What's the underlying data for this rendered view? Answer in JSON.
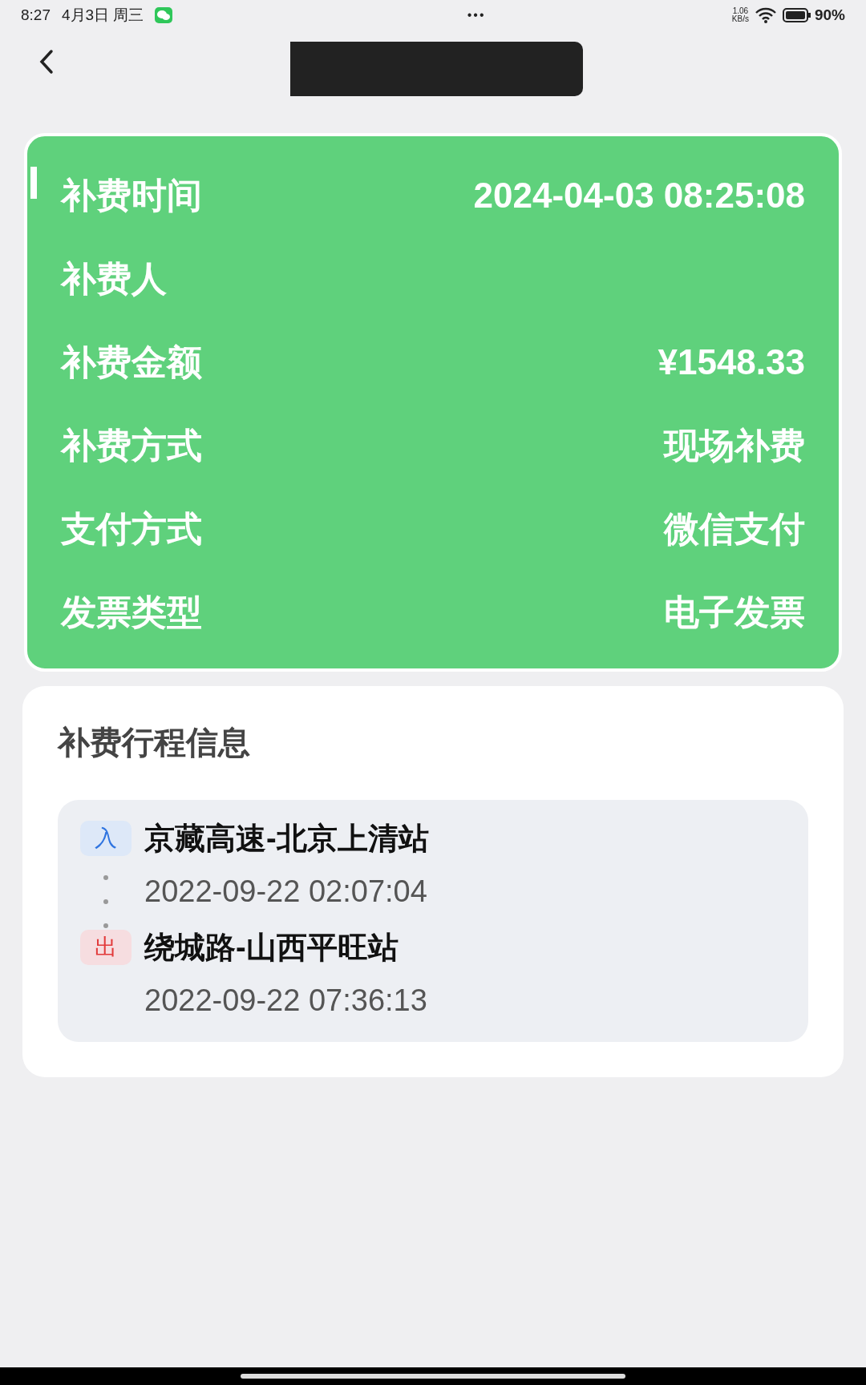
{
  "status_bar": {
    "time": "8:27",
    "date": "4月3日 周三",
    "dots": "•••",
    "speed": "1.06",
    "speed_unit": "KB/s",
    "battery": "90%"
  },
  "details": [
    {
      "label": "补费时间",
      "value": "2024-04-03 08:25:08"
    },
    {
      "label": "补费人"
    },
    {
      "label": "补费金额",
      "value": "¥1548.33"
    },
    {
      "label": "补费方式",
      "value": "现场补费"
    },
    {
      "label": "支付方式",
      "value": "微信支付"
    },
    {
      "label": "发票类型",
      "value": "电子发票"
    }
  ],
  "trip": {
    "title": "补费行程信息",
    "stops": [
      {
        "kind": "entry",
        "badge": "入",
        "station": "京藏高速-北京上清站",
        "time": "2022-09-22 02:07:04"
      },
      {
        "kind": "exit",
        "badge": "出",
        "station": "绕城路-山西平旺站",
        "time": "2022-09-22 07:36:13"
      }
    ]
  }
}
